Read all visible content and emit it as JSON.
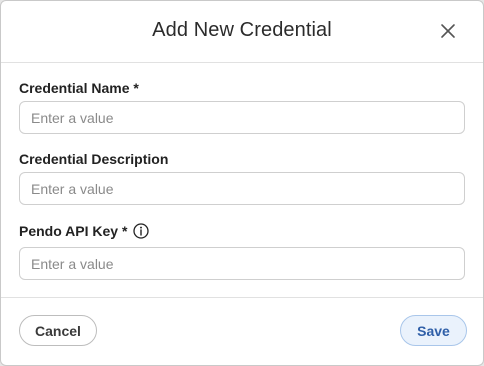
{
  "dialog": {
    "title": "Add New Credential",
    "close_icon": "close-icon"
  },
  "fields": {
    "name": {
      "label": "Credential Name *",
      "placeholder": "Enter a value",
      "value": ""
    },
    "description": {
      "label": "Credential Description",
      "placeholder": "Enter a value",
      "value": ""
    },
    "api_key": {
      "label": "Pendo API Key *",
      "placeholder": "Enter a value",
      "value": "",
      "help_icon": "info-icon"
    }
  },
  "footer": {
    "cancel_label": "Cancel",
    "save_label": "Save"
  },
  "colors": {
    "save_text": "#2f5fa8",
    "save_bg": "#eaf2fc",
    "save_border": "#a9c6ea"
  }
}
